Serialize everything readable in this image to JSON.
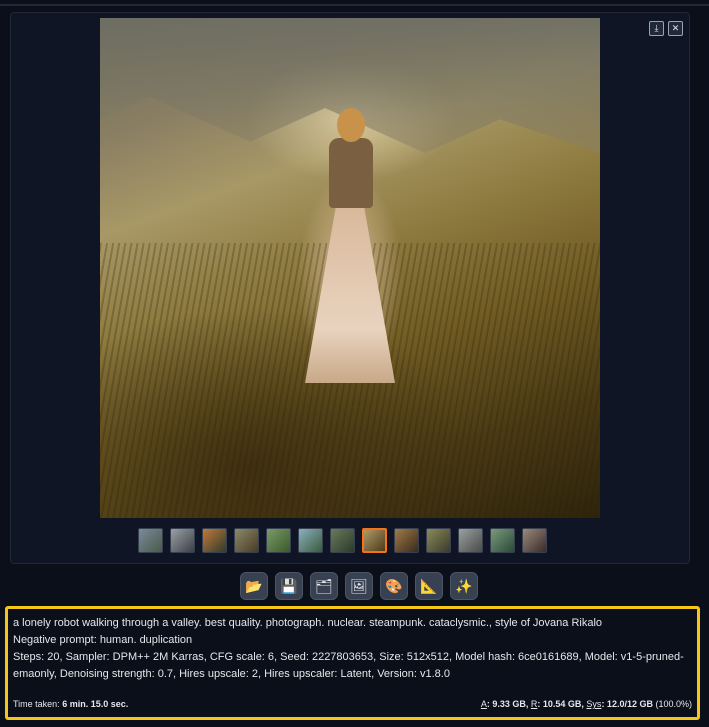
{
  "gallery": {
    "download_icon": "download-icon",
    "close_icon": "close-icon",
    "download_glyph": "⤓",
    "close_glyph": "✕",
    "selected_thumbnail_index": 7,
    "thumbnail_count": 13
  },
  "actions": [
    {
      "name": "open-folder-button",
      "icon": "folder-icon",
      "glyph": "📂"
    },
    {
      "name": "save-button",
      "icon": "save-icon",
      "glyph": "💾"
    },
    {
      "name": "zip-button",
      "icon": "zip-icon",
      "glyph": "🗂"
    },
    {
      "name": "send-to-img2img-button",
      "icon": "image-icon",
      "glyph": "🖼"
    },
    {
      "name": "send-to-inpaint-button",
      "icon": "palette-icon",
      "glyph": "🎨"
    },
    {
      "name": "send-to-extras-button",
      "icon": "ruler-icon",
      "glyph": "📐"
    },
    {
      "name": "send-to-other-button",
      "icon": "sparkle-icon",
      "glyph": "✨"
    }
  ],
  "info": {
    "prompt": "a lonely robot walking through a valley. best quality. photograph. nuclear. steampunk. cataclysmic., style of Jovana Rikalo",
    "negative_prompt": "Negative prompt: human. duplication",
    "params": "Steps: 20, Sampler: DPM++ 2M Karras, CFG scale: 6, Seed: 2227803653, Size: 512x512, Model hash: 6ce0161689, Model: v1-5-pruned-emaonly, Denoising strength: 0.7, Hires upscale: 2, Hires upscaler: Latent, Version: v1.8.0",
    "time_label": "Time taken: ",
    "time_value": "6 min. 15.0 sec.",
    "mem_a_label": "A",
    "mem_a_value": ": 9.33 GB, ",
    "mem_r_label": "R",
    "mem_r_value": ": 10.54 GB, ",
    "mem_sys_label": "Sys",
    "mem_sys_value": ": 12.0/12 GB",
    "mem_percent": " (100.0%)"
  },
  "colors": {
    "highlight": "#f5c518",
    "selected_thumb": "#f97316",
    "background": "#0b0f19"
  }
}
